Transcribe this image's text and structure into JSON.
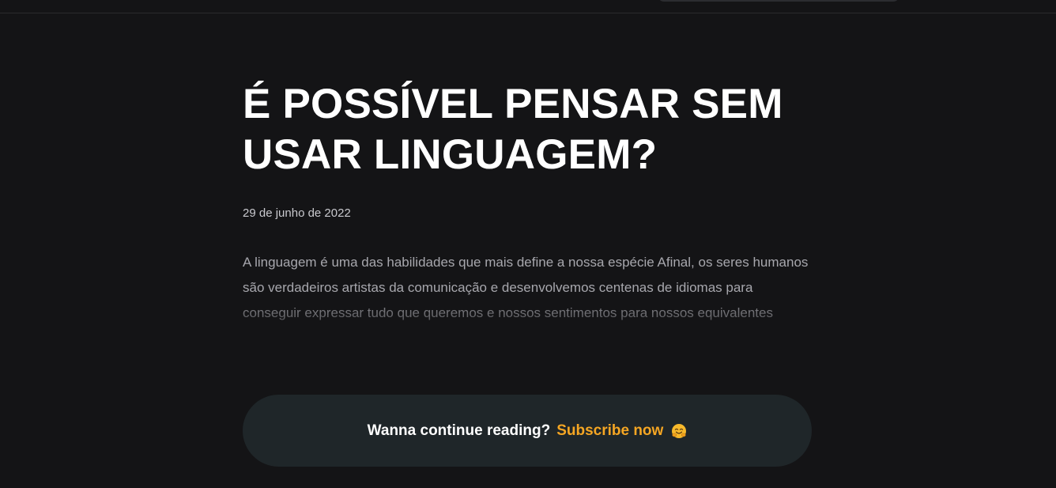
{
  "article": {
    "title": "É POSSÍVEL PENSAR SEM USAR LINGUAGEM?",
    "date": "29 de junho de 2022",
    "excerpt": "A linguagem é uma das habilidades que mais define a nossa espécie Afinal, os seres humanos são verdadeiros artistas da comunicação e desenvolvemos centenas de idiomas para conseguir expressar tudo que queremos e nossos sentimentos para nossos equivalentes"
  },
  "cta": {
    "prompt": "Wanna continue reading?",
    "link_label": "Subscribe now",
    "emoji_icon": "hugging-face-emoji"
  },
  "colors": {
    "background": "#141416",
    "accent": "#f5a623",
    "cta_background": "#1f2629"
  }
}
